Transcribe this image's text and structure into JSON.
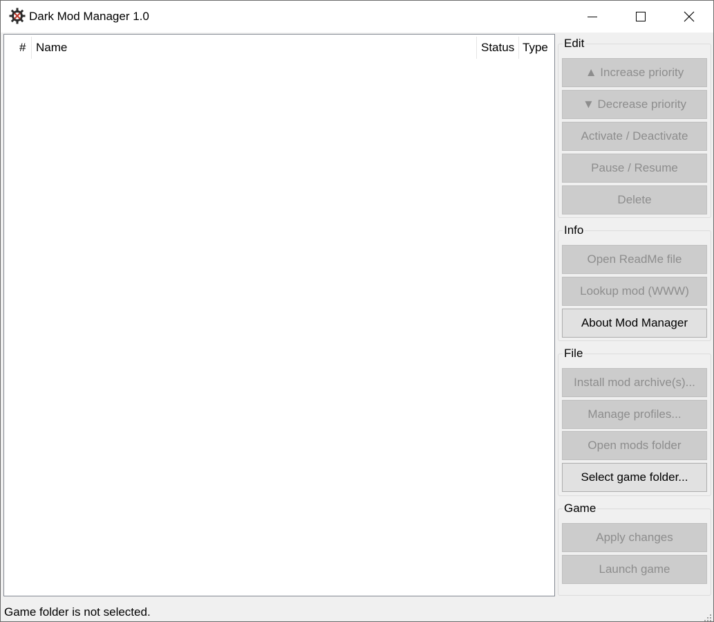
{
  "window": {
    "title": "Dark Mod Manager 1.0"
  },
  "titlebar_icons": {
    "app": "gear-icon",
    "minimize": "minimize-icon",
    "maximize": "maximize-icon",
    "close": "close-icon"
  },
  "mod_list": {
    "columns": [
      "#",
      "Name",
      "Status",
      "Type"
    ],
    "rows": []
  },
  "groups": {
    "edit": {
      "title": "Edit",
      "buttons": {
        "increase": "▲ Increase priority",
        "decrease": "▼ Decrease priority",
        "activate": "Activate / Deactivate",
        "pause": "Pause / Resume",
        "delete": "Delete"
      }
    },
    "info": {
      "title": "Info",
      "buttons": {
        "readme": "Open ReadMe file",
        "lookup": "Lookup mod (WWW)",
        "about": "About Mod Manager"
      }
    },
    "file": {
      "title": "File",
      "buttons": {
        "install": "Install mod archive(s)...",
        "profiles": "Manage profiles...",
        "open_mods": "Open mods folder",
        "select_game": "Select game folder..."
      }
    },
    "game": {
      "title": "Game",
      "buttons": {
        "apply": "Apply changes",
        "launch": "Launch game"
      }
    }
  },
  "status": {
    "text": "Game folder is not selected."
  },
  "colors": {
    "button_disabled_bg": "#cccccc",
    "button_disabled_text": "#8d8d8d",
    "button_enabled_bg": "#e1e1e1"
  }
}
